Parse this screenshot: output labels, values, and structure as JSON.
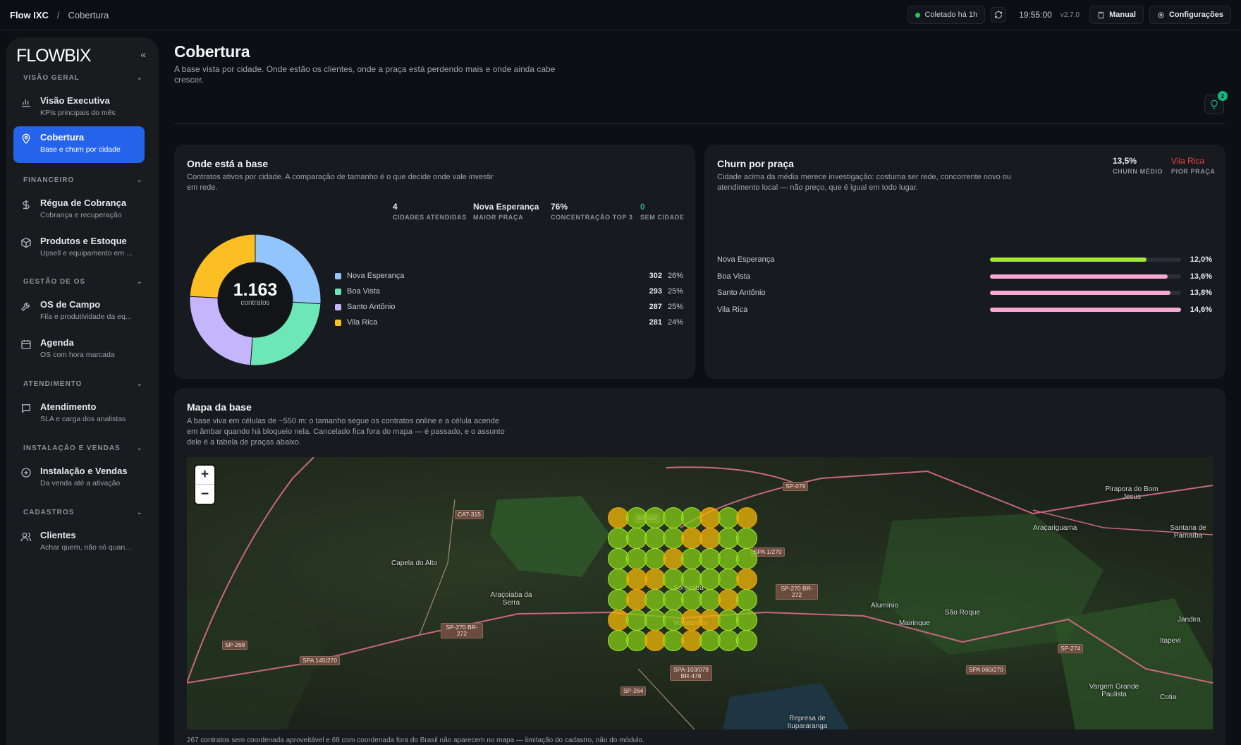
{
  "topbar": {
    "app": "Flow IXC",
    "separator": "/",
    "page": "Cobertura",
    "collected": "Coletado há 1h",
    "time": "19:55:00",
    "version": "v2.7.0",
    "manual": "Manual",
    "settings": "Configurações"
  },
  "sidebar": {
    "logo": "FLOWBIX",
    "collapse_glyph": "«",
    "sections": [
      {
        "label": "VISÃO GERAL"
      },
      {
        "label": "FINANCEIRO"
      },
      {
        "label": "GESTÃO DE OS"
      },
      {
        "label": "ATENDIMENTO"
      },
      {
        "label": "INSTALAÇÃO E VENDAS"
      },
      {
        "label": "CADASTROS"
      }
    ],
    "items": [
      {
        "title": "Visão Executiva",
        "subtitle": "KPIs principais do mês",
        "icon": "bar-chart-icon"
      },
      {
        "title": "Cobertura",
        "subtitle": "Base e churn por cidade",
        "icon": "map-pin-icon"
      },
      {
        "title": "Régua de Cobrança",
        "subtitle": "Cobrança e recuperação",
        "icon": "dollar-icon"
      },
      {
        "title": "Produtos e Estoque",
        "subtitle": "Upsell e equipamento em ...",
        "icon": "box-icon"
      },
      {
        "title": "OS de Campo",
        "subtitle": "Fila e produtividade da eq...",
        "icon": "wrench-icon"
      },
      {
        "title": "Agenda",
        "subtitle": "OS com hora marcada",
        "icon": "calendar-icon"
      },
      {
        "title": "Atendimento",
        "subtitle": "SLA e carga dos analistas",
        "icon": "chat-icon"
      },
      {
        "title": "Instalação e Vendas",
        "subtitle": "Da venda até a ativação",
        "icon": "plus-circle-icon"
      },
      {
        "title": "Clientes",
        "subtitle": "Achar quem, não só quan...",
        "icon": "users-icon"
      }
    ]
  },
  "header": {
    "title": "Cobertura",
    "subtitle": "A base vista por cidade. Onde estão os clientes, onde a praça está perdendo mais e onde ainda cabe crescer.",
    "notifications": "2"
  },
  "base_card": {
    "title": "Onde está a base",
    "subtitle": "Contratos ativos por cidade. A comparação de tamanho é o que decide onde vale investir em rede.",
    "stats": [
      {
        "value": "4",
        "label": "CIDADES ATENDIDAS"
      },
      {
        "value": "Nova Esperança",
        "label": "MAIOR PRAÇA"
      },
      {
        "value": "76%",
        "label": "CONCENTRAÇÃO TOP 3"
      },
      {
        "value": "0",
        "label": "SEM CIDADE"
      }
    ],
    "donut_total": "1.163",
    "donut_unit": "contratos",
    "cities": [
      {
        "name": "Nova Esperança",
        "count": "302",
        "pct": "26%",
        "color": "#93c5fd"
      },
      {
        "name": "Boa Vista",
        "count": "293",
        "pct": "25%",
        "color": "#6ee7b7"
      },
      {
        "name": "Santo Antônio",
        "count": "287",
        "pct": "25%",
        "color": "#c4b5fd"
      },
      {
        "name": "Vila Rica",
        "count": "281",
        "pct": "24%",
        "color": "#fbbf24"
      }
    ]
  },
  "churn_card": {
    "title": "Churn por praça",
    "subtitle": "Cidade acima da média merece investigação: costuma ser rede, concorrente novo ou atendimento local — não preço, que é igual em todo lugar.",
    "avg_value": "13,5%",
    "avg_label": "CHURN MÉDIO",
    "worst_value": "Vila Rica",
    "worst_label": "PIOR PRAÇA",
    "rows": [
      {
        "name": "Nova Esperança",
        "value": "12,0%",
        "fraction": 0.82,
        "color": "#a3e635"
      },
      {
        "name": "Boa Vista",
        "value": "13,6%",
        "fraction": 0.93,
        "color": "#f9a8d4"
      },
      {
        "name": "Santo Antônio",
        "value": "13,8%",
        "fraction": 0.945,
        "color": "#f9a8d4"
      },
      {
        "name": "Vila Rica",
        "value": "14,6%",
        "fraction": 1.0,
        "color": "#f9a8d4"
      }
    ]
  },
  "map_card": {
    "title": "Mapa da base",
    "subtitle": "A base viva em células de ~550 m: o tamanho segue os contratos online e a célula acende em âmbar quando há bloqueio nela. Cancelado fica fora do mapa — é passado, e o assunto dele é a tabela de praças abaixo.",
    "zoom_in": "+",
    "zoom_out": "−",
    "labels": [
      "Capela do Alto",
      "Araçoiaba da Serra",
      "Sorocaba",
      "Votorantim",
      "Alumínio",
      "Mairinque",
      "São Roque",
      "Araçariguama",
      "Pirapora do Bom Jesus",
      "Santana de Parnaíba",
      "Itapevi",
      "Vargem Grande Paulista",
      "Cotia",
      "Jandira",
      "Represa de Itupararanga"
    ],
    "roads": [
      "SP-079",
      "SP-097",
      "CAT-315",
      "SP-270 BR-272",
      "SP-268",
      "SPA 145/270",
      "SP-264",
      "SPA-103/079 BR-478",
      "SP-274",
      "SPA 060/270",
      "SPA 1/270",
      "SP-270 BR-272"
    ],
    "footnote": "267 contratos sem coordenada aproveitável e 68 com coordenada fora do Brasil não aparecem no mapa — limitação do cadastro, não do módulo."
  }
}
